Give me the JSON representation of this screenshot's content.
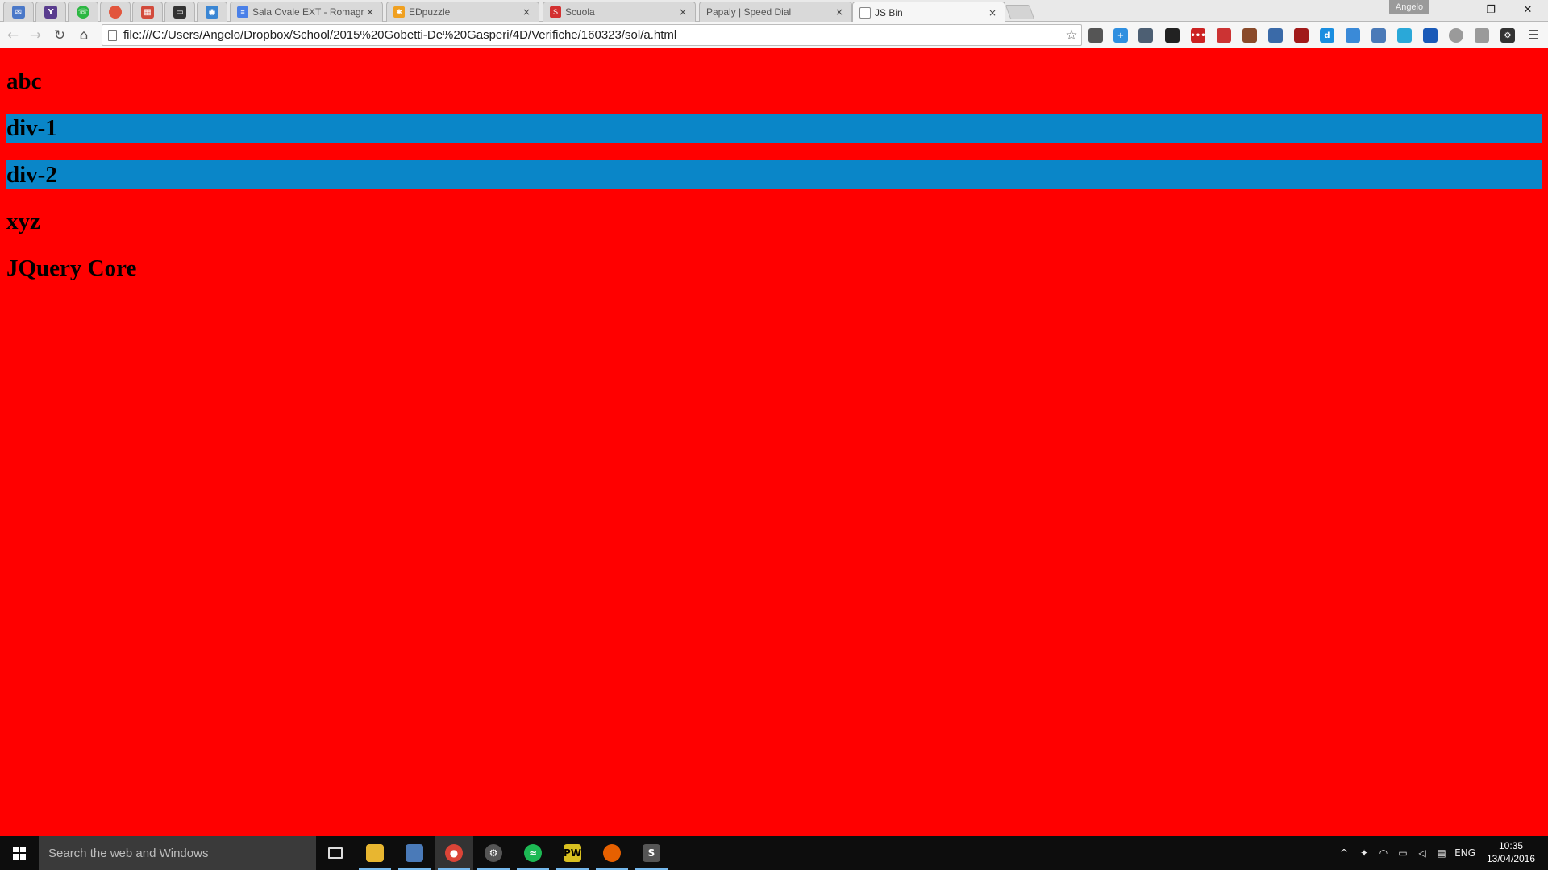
{
  "browser": {
    "pinned_tabs": [
      {
        "icon": "gmail-inbox-icon",
        "color": "#4a78c8"
      },
      {
        "icon": "yahoo-icon",
        "color": "#5a3d8f"
      },
      {
        "icon": "whatsapp-icon",
        "color": "#2cb742"
      },
      {
        "icon": "tomato-timer-icon",
        "color": "#e2553c"
      },
      {
        "icon": "calendar-icon",
        "color": "#d24a3b"
      },
      {
        "icon": "tv-icon",
        "color": "#333333"
      },
      {
        "icon": "camera-icon",
        "color": "#3a86d4"
      }
    ],
    "tabs": [
      {
        "title": "Sala Ovale EXT - Romagn",
        "icon": "google-docs-icon",
        "color": "#4a80e8"
      },
      {
        "title": "EDpuzzle",
        "icon": "edpuzzle-icon",
        "color": "#f0a020"
      },
      {
        "title": "Scuola",
        "icon": "scuola-icon",
        "color": "#d33030"
      },
      {
        "title": "Papaly | Speed Dial",
        "icon": "",
        "color": "#d9d9d9"
      },
      {
        "title": "JS Bin",
        "icon": "page-icon",
        "color": "#ffffff"
      }
    ],
    "close_glyph": "×",
    "profile_name": "Angelo",
    "window_buttons": {
      "minimize": "–",
      "restore": "❐",
      "close": "✕"
    },
    "toolbar": {
      "back": "←",
      "forward": "→",
      "reload": "↻",
      "home": "⌂",
      "url": "file:///C:/Users/Angelo/Dropbox/School/2015%20Gobetti-De%20Gasperi/4D/Verifiche/160323/sol/a.html",
      "star": "☆"
    },
    "extensions": [
      {
        "icon": "pocket-icon",
        "color": "#555555",
        "glyph": ""
      },
      {
        "icon": "plus-extension-icon",
        "color": "#2f8fe0",
        "glyph": "+"
      },
      {
        "icon": "tab-counter-icon",
        "color": "#4d5f73",
        "glyph": ""
      },
      {
        "icon": "binoculars-icon",
        "color": "#222222",
        "glyph": ""
      },
      {
        "icon": "lastpass-icon",
        "color": "#cc2222",
        "glyph": "•••"
      },
      {
        "icon": "bookmark-red-icon",
        "color": "#cc3333",
        "glyph": ""
      },
      {
        "icon": "toolbox-icon",
        "color": "#8a4a2a",
        "glyph": ""
      },
      {
        "icon": "screenshot-icon",
        "color": "#3a6aa8",
        "glyph": ""
      },
      {
        "icon": "ublock-icon",
        "color": "#a11a1a",
        "glyph": ""
      },
      {
        "icon": "d-extension-icon",
        "color": "#1a8ee0",
        "glyph": "d"
      },
      {
        "icon": "window-icon",
        "color": "#3a8ad8",
        "glyph": ""
      },
      {
        "icon": "capture-icon",
        "color": "#4a7ab8",
        "glyph": ""
      },
      {
        "icon": "chat-icon",
        "color": "#2aa8d8",
        "glyph": ""
      },
      {
        "icon": "translate-icon",
        "color": "#1a5ab8",
        "glyph": ""
      },
      {
        "icon": "magnifier-icon",
        "color": "#9a9a9a",
        "glyph": ""
      },
      {
        "icon": "shield-grey-icon",
        "color": "#9a9a9a",
        "glyph": ""
      },
      {
        "icon": "settings-gear-icon",
        "color": "#333333",
        "glyph": "⚙"
      }
    ]
  },
  "page": {
    "heading_abc": "abc",
    "div1": "div-1",
    "div2": "div-2",
    "heading_xyz": "xyz",
    "heading_jquery": "JQuery Core",
    "background_color": "#ff0000",
    "div_color": "#0a86c8"
  },
  "taskbar": {
    "search_placeholder": "Search the web and Windows",
    "apps": [
      {
        "icon": "task-view-icon",
        "color": "#0d0d0d",
        "running": false
      },
      {
        "icon": "file-explorer-icon",
        "color": "#e8b630",
        "running": true
      },
      {
        "icon": "network-icon",
        "color": "#4a7ab8",
        "running": true
      },
      {
        "icon": "chrome-icon",
        "color": "#db4437",
        "running": true
      },
      {
        "icon": "app-gear-icon",
        "color": "#555555",
        "running": true
      },
      {
        "icon": "spotify-icon",
        "color": "#1db954",
        "running": true
      },
      {
        "icon": "pw-icon",
        "color": "#d8c020",
        "running": true
      },
      {
        "icon": "firefox-icon",
        "color": "#e66000",
        "running": true
      },
      {
        "icon": "sublime-icon",
        "color": "#555555",
        "running": true
      }
    ],
    "tray": {
      "chevron": "^",
      "language": "ENG",
      "time": "10:35",
      "date": "13/04/2016"
    }
  }
}
